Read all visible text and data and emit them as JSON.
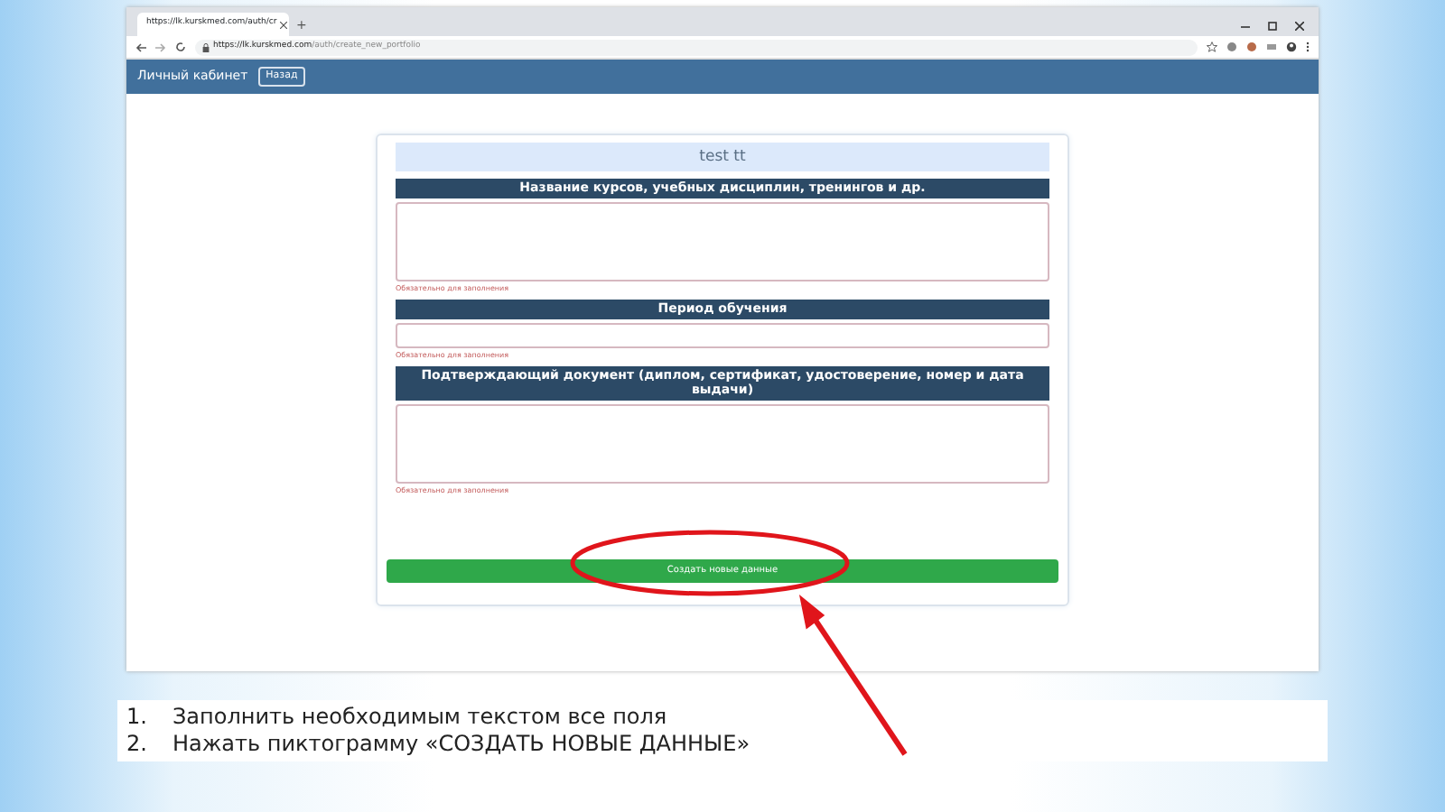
{
  "browser": {
    "tab_title": "https://lk.kurskmed.com/auth/cr",
    "new_tab": "+",
    "url_host": "https://lk.kurskmed.com",
    "url_path": "/auth/create_new_portfolio"
  },
  "navbar": {
    "brand": "Личный кабинет",
    "back_button": "Назад"
  },
  "form": {
    "title": "test tt",
    "sections": [
      {
        "heading": "Название курсов, учебных дисциплин, тренингов и др.",
        "kind": "textarea",
        "hint": "Обязательно для заполнения"
      },
      {
        "heading": "Период обучения",
        "kind": "input",
        "hint": "Обязательно для заполнения"
      },
      {
        "heading": "Подтверждающий документ (диплом, сертификат, удостоверение, номер и дата выдачи)",
        "kind": "textarea",
        "hint": "Обязательно для заполнения"
      }
    ],
    "submit_button": "Создать новые данные"
  },
  "instructions": [
    {
      "number": "1.",
      "text": "Заполнить необходимым текстом все поля"
    },
    {
      "number": "2.",
      "text": "Нажать пиктограмму «СОЗДАТЬ НОВЫЕ ДАННЫЕ»"
    }
  ]
}
